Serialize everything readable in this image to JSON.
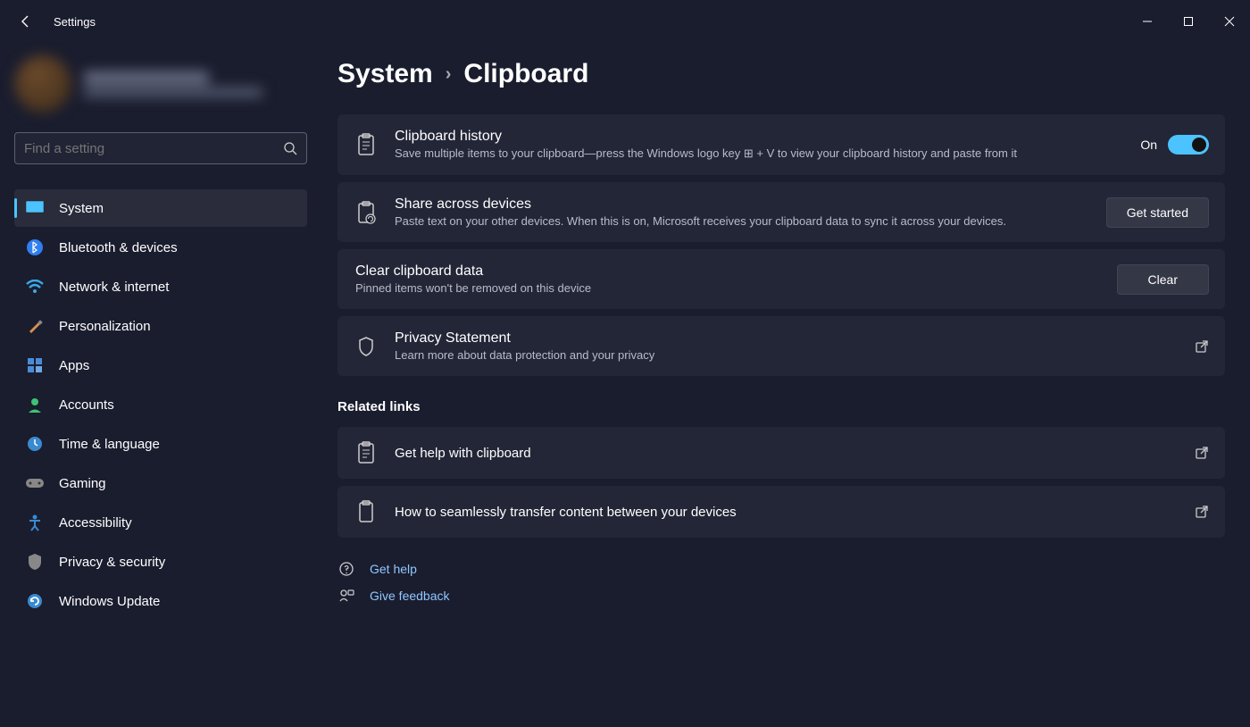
{
  "titlebar": {
    "app_name": "Settings"
  },
  "search": {
    "placeholder": "Find a setting"
  },
  "sidebar": {
    "items": [
      {
        "label": "System"
      },
      {
        "label": "Bluetooth & devices"
      },
      {
        "label": "Network & internet"
      },
      {
        "label": "Personalization"
      },
      {
        "label": "Apps"
      },
      {
        "label": "Accounts"
      },
      {
        "label": "Time & language"
      },
      {
        "label": "Gaming"
      },
      {
        "label": "Accessibility"
      },
      {
        "label": "Privacy & security"
      },
      {
        "label": "Windows Update"
      }
    ]
  },
  "breadcrumb": {
    "parent": "System",
    "current": "Clipboard"
  },
  "cards": {
    "history": {
      "title": "Clipboard history",
      "desc": "Save multiple items to your clipboard—press the Windows logo key ⊞ + V to view your clipboard history and paste from it",
      "toggle_label": "On"
    },
    "share": {
      "title": "Share across devices",
      "desc": "Paste text on your other devices. When this is on, Microsoft receives your clipboard data to sync it across your devices.",
      "button": "Get started"
    },
    "clear": {
      "title": "Clear clipboard data",
      "desc": "Pinned items won't be removed on this device",
      "button": "Clear"
    },
    "privacy": {
      "title": "Privacy Statement",
      "desc": "Learn more about data protection and your privacy"
    }
  },
  "related": {
    "heading": "Related links",
    "help_clipboard": "Get help with clipboard",
    "transfer": "How to seamlessly transfer content between your devices"
  },
  "footer": {
    "get_help": "Get help",
    "feedback": "Give feedback"
  }
}
